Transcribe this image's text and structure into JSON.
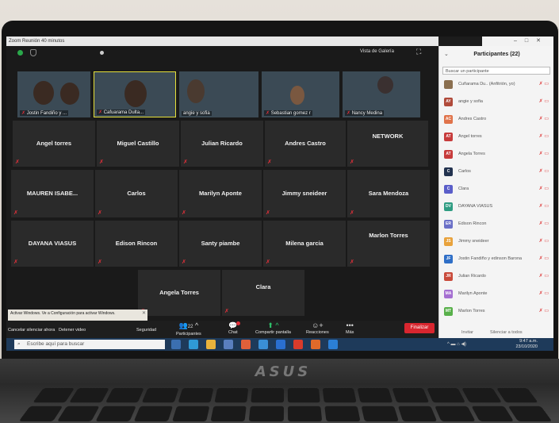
{
  "window_title": "Zoom Reunión 40 minutos",
  "topbar": {
    "subtitle": "",
    "view_label": "Vista de Galería"
  },
  "tiles_row1": [
    {
      "name": "Jostin Fandiño y ...",
      "muted": true
    },
    {
      "name": "Cafuarama Dulta...",
      "muted": true
    },
    {
      "name": "angie y sofia",
      "muted": false
    },
    {
      "name": "Sebastian gomez r",
      "muted": true
    },
    {
      "name": "Nancy Medina",
      "muted": true
    }
  ],
  "tiles_row2": [
    "Angel torres",
    "Miguel Castillo",
    "Julian Ricardo",
    "Andres Castro",
    "NETWORK"
  ],
  "tiles_row3": [
    "MAUREN ISABE...",
    "Carlos",
    "Marilyn Aponte",
    "Jimmy sneideer",
    "Sara Mendoza"
  ],
  "tiles_row4": [
    "DAYANA VIASUS",
    "Edison Rincon",
    "Santy piambe",
    "Milena garcia",
    "Marlon Torres"
  ],
  "tiles_row5": [
    "Angela Torres",
    "Clara"
  ],
  "notification": "Activar Windows. Ve a Configuración para activar Windows.",
  "toolbar": {
    "unmute": "Cancelar silenciar ahora",
    "video": "Detener video",
    "security": "Seguridad",
    "participants": "Participantes",
    "participants_count": "22",
    "chat": "Chat",
    "share": "Compartir pantalla",
    "reactions": "Reacciones",
    "more": "Más",
    "end": "Finalizar"
  },
  "panel": {
    "title": "Participantes (22)",
    "search_placeholder": "Buscar un participante",
    "participants": [
      {
        "initials": "",
        "name": "Cuñarama Du.. (Anfitrión, yo)",
        "color": "#8a6f4f"
      },
      {
        "initials": "AY",
        "name": "angie y sofia",
        "color": "#b04a3a"
      },
      {
        "initials": "AC",
        "name": "Andres Castro",
        "color": "#e0734a"
      },
      {
        "initials": "AT",
        "name": "Angel torres",
        "color": "#c73b3b"
      },
      {
        "initials": "AT",
        "name": "Angela Torres",
        "color": "#c73b3b"
      },
      {
        "initials": "C",
        "name": "Carlos",
        "color": "#23334f"
      },
      {
        "initials": "C",
        "name": "Clara",
        "color": "#5a5ec9"
      },
      {
        "initials": "DV",
        "name": "DAYANA VIASUS",
        "color": "#2e9c82"
      },
      {
        "initials": "ER",
        "name": "Edison Rincon",
        "color": "#6a6fc7"
      },
      {
        "initials": "JS",
        "name": "Jimmy sneideer",
        "color": "#e8a23c"
      },
      {
        "initials": "JF",
        "name": "Jostin Fandiño y edinson Barona",
        "color": "#2f6fc7"
      },
      {
        "initials": "JR",
        "name": "Julian Ricardo",
        "color": "#c94a3a"
      },
      {
        "initials": "MA",
        "name": "Marilyn Aponte",
        "color": "#a56fd1"
      },
      {
        "initials": "MT",
        "name": "Marlon Torres",
        "color": "#58b04a"
      }
    ],
    "footer_invite": "Invitar",
    "footer_mute": "Silenciar a todos"
  },
  "taskbar": {
    "search": "Escribe aquí para buscar",
    "time": "9:47 a.m.",
    "date": "23/10/2020"
  },
  "brand": "ASUS"
}
